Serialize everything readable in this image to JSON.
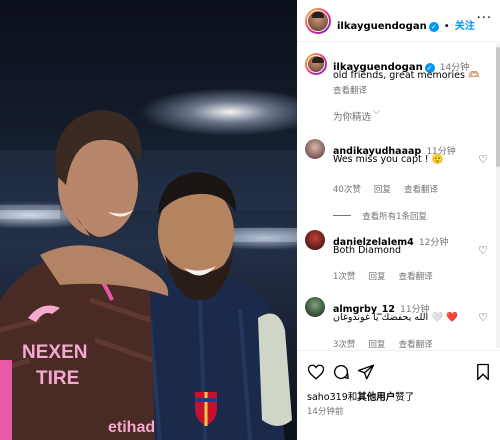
{
  "post": {
    "username": "ilkayguendogan",
    "follow_label": "关注",
    "separator": "•",
    "more_label": "···"
  },
  "caption": {
    "username": "ilkayguendogan",
    "time": "14分钟",
    "text": "old friends, great memories 🫶🏼",
    "translate": "查看翻译"
  },
  "filter": {
    "label": "为你精选",
    "chevron": "⌵"
  },
  "comments": [
    {
      "username": "andikayudhaaap",
      "time": "11分钟",
      "text": "Wes miss you capt ! 🫡",
      "likes": "40次赞",
      "reply": "回复",
      "translate": "查看翻译",
      "view_replies": "查看所有1条回复"
    },
    {
      "username": "danielzelalem4",
      "time": "12分钟",
      "text": "Both Diamond",
      "likes": "1次赞",
      "reply": "回复",
      "translate": "查看翻译"
    },
    {
      "username": "almgrby_12",
      "time": "11分钟",
      "text": "الله يحفضك يا غوندوغان 🤍 ❤️",
      "likes": "3次赞",
      "reply": "回复",
      "translate": "查看翻译"
    }
  ],
  "footer": {
    "liked_by_prefix": "saho319和",
    "liked_by_bold": "其他用户",
    "liked_by_suffix": "赞了",
    "time": "14分钟前"
  },
  "photo": {
    "jersey_text_1": "NEXEN",
    "jersey_text_2": "TIRE",
    "jersey_text_3": "etihad"
  },
  "colors": {
    "accent": "#0095f6",
    "muted": "#737373",
    "keeper_kit": "#4a2a24",
    "barca_kit": "#1b2a4a"
  }
}
